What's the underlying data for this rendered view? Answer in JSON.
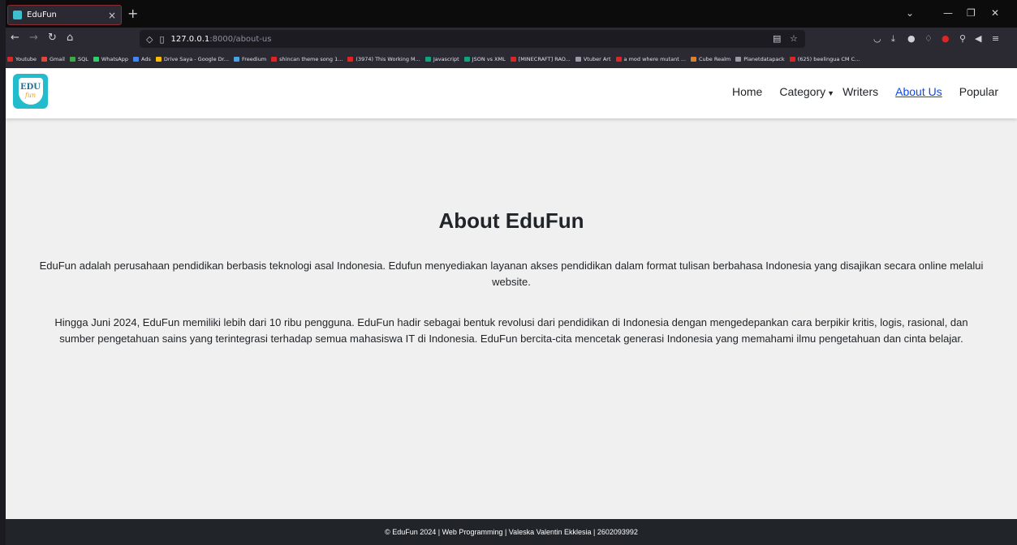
{
  "browser": {
    "tab_title": "EduFun",
    "tab_close": "×",
    "new_tab": "+",
    "window_controls": [
      "⌄",
      "—",
      "❐",
      "✕"
    ],
    "url_host": "127.0.0.1",
    "url_path": ":8000/about-us"
  },
  "bookmarks": [
    {
      "label": "Youtube",
      "color": "#e02424"
    },
    {
      "label": "Gmail",
      "color": "#ea4335"
    },
    {
      "label": "SQL",
      "color": "#3fa64a"
    },
    {
      "label": "WhatsApp",
      "color": "#25d366"
    },
    {
      "label": "Ads",
      "color": "#4285f4"
    },
    {
      "label": "Drive Saya - Google Dr...",
      "color": "#fbbc04"
    },
    {
      "label": "Freedium",
      "color": "#4aa3df"
    },
    {
      "label": "shincan theme song 1...",
      "color": "#e02424"
    },
    {
      "label": "(3974) This Working M...",
      "color": "#e02424"
    },
    {
      "label": "Javascript",
      "color": "#11a37f"
    },
    {
      "label": "JSON vs XML",
      "color": "#11a37f"
    },
    {
      "label": "[MINECRAFT] RAO...",
      "color": "#e02424"
    },
    {
      "label": "Vtuber Art",
      "color": "#9a9aa6"
    },
    {
      "label": "a mod where mutant ...",
      "color": "#e02424"
    },
    {
      "label": "Cube Realm",
      "color": "#d9822b"
    },
    {
      "label": "Planetdatapack",
      "color": "#9a9aa6"
    },
    {
      "label": "(625) beelingua CM C...",
      "color": "#e02424"
    }
  ],
  "site": {
    "logo_line1": "EDU",
    "logo_line2": "fun",
    "nav": {
      "home": "Home",
      "category": "Category",
      "writers": "Writers",
      "about": "About Us",
      "popular": "Popular"
    }
  },
  "content": {
    "title": "About EduFun",
    "paragraph1": "EduFun adalah perusahaan pendidikan berbasis teknologi asal Indonesia. Edufun menyediakan layanan akses pendidikan dalam format tulisan berbahasa Indonesia yang disajikan secara online melalui website.",
    "paragraph2": "Hingga Juni 2024, EduFun memiliki lebih dari 10 ribu pengguna. EduFun hadir sebagai bentuk revolusi dari pendidikan di Indonesia dengan mengedepankan cara berpikir kritis, logis, rasional, dan sumber pengetahuan sains yang terintegrasi terhadap semua mahasiswa IT di Indonesia. EduFun bercita-cita mencetak generasi Indonesia yang memahami ilmu pengetahuan dan cinta belajar."
  },
  "footer": {
    "text": "© EduFun 2024 | Web Programming | Valeska Valentin Ekklesia | 2602093992"
  },
  "colors": {
    "accent": "#22bccd",
    "link_active": "#0d47f2",
    "footer_bg": "#212529"
  }
}
